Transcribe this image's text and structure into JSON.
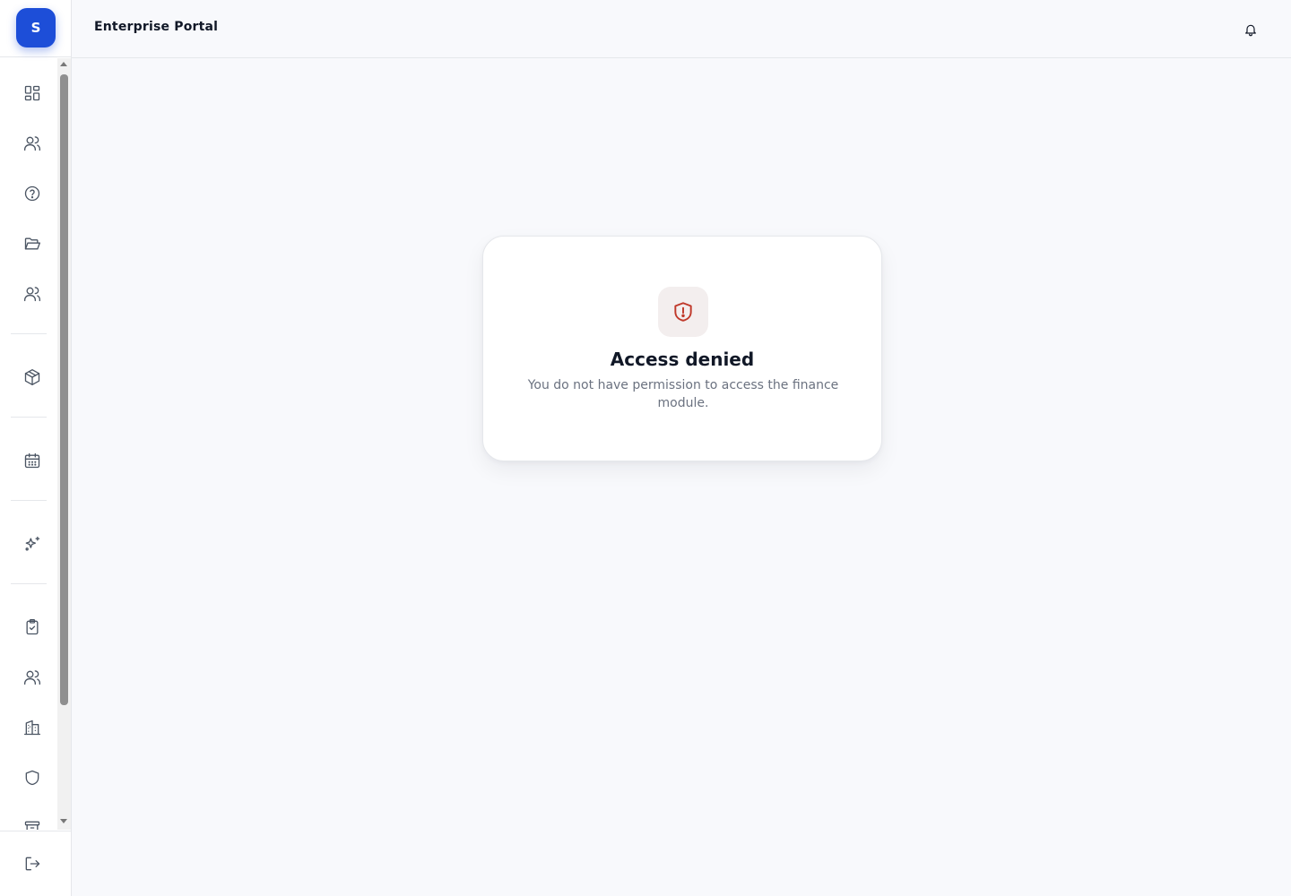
{
  "sidebar": {
    "brand_initial": "S",
    "nav_icons": [
      "dashboard-icon",
      "users-icon",
      "help-circle-icon",
      "folder-open-icon",
      "team-icon",
      "package-icon",
      "calendar-icon",
      "sparkles-icon",
      "clipboard-check-icon",
      "people-icon",
      "building-icon",
      "shield-icon",
      "archive-icon"
    ],
    "footer_icon": "logout-icon"
  },
  "header": {
    "title": "Enterprise Portal",
    "notification_icon": "bell-icon"
  },
  "access_card": {
    "icon": "shield-alert-icon",
    "title": "Access denied",
    "message": "You do not have permission to access the finance module."
  },
  "colors": {
    "brand": "#1d4ed8",
    "alert": "#c0392b",
    "alert_bg": "#f3eeee",
    "page_bg": "#f8f9fc",
    "icon_stroke": "#4b5563"
  }
}
